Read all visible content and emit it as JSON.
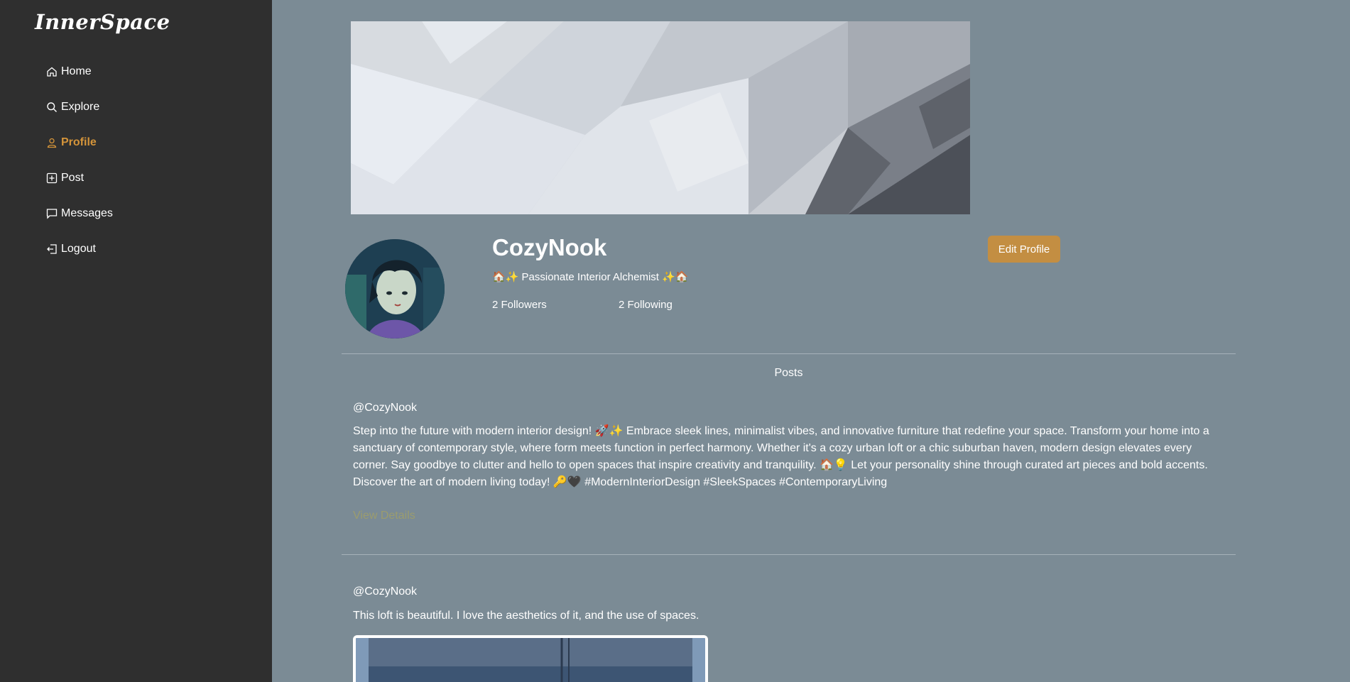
{
  "sidebar": {
    "brand": "InnerSpace",
    "items": [
      {
        "label": "Home",
        "icon": "home-icon"
      },
      {
        "label": "Explore",
        "icon": "search-icon"
      },
      {
        "label": "Profile",
        "icon": "user-icon",
        "active": true
      },
      {
        "label": "Post",
        "icon": "plus-square-icon"
      },
      {
        "label": "Messages",
        "icon": "chat-icon"
      },
      {
        "label": "Logout",
        "icon": "logout-icon"
      }
    ]
  },
  "profile": {
    "username": "CozyNook",
    "bio": "🏠✨ Passionate Interior Alchemist ✨🏠",
    "followers": "2 Followers",
    "following": "2 Following",
    "edit_label": "Edit Profile"
  },
  "posts_heading": "Posts",
  "posts": [
    {
      "author": "@CozyNook",
      "text": "Step into the future with modern interior design! 🚀✨ Embrace sleek lines, minimalist vibes, and innovative furniture that redefine your space. Transform your home into a sanctuary of contemporary style, where form meets function in perfect harmony. Whether it's a cozy urban loft or a chic suburban haven, modern design elevates every corner. Say goodbye to clutter and hello to open spaces that inspire creativity and tranquility. 🏠💡 Let your personality shine through curated art pieces and bold accents. Discover the art of modern living today! 🔑🖤 #ModernInteriorDesign #SleekSpaces #ContemporaryLiving",
      "view_details": "View Details"
    },
    {
      "author": "@CozyNook",
      "text": "This loft is beautiful. I love the aesthetics of it, and the use of spaces."
    }
  ],
  "colors": {
    "sidebar_bg": "#2f2f2f",
    "page_bg": "#7b8b95",
    "accent": "#d4943a",
    "button": "#c38e42",
    "link_muted": "#9b9c6e"
  }
}
